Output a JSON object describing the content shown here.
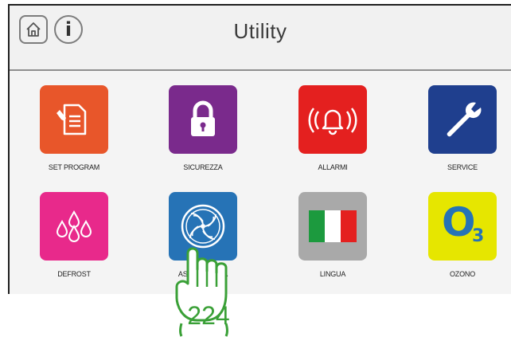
{
  "header": {
    "title": "Utility",
    "home_icon": "home-icon",
    "info_icon": "info-icon",
    "info_glyph": "i"
  },
  "tiles": [
    {
      "label": "SET PROGRAM",
      "icon": "document-edit-icon",
      "color": "#e8562a"
    },
    {
      "label": "SICUREZZA",
      "icon": "padlock-icon",
      "color": "#7a2a8c"
    },
    {
      "label": "ALLARMI",
      "icon": "alarm-bell-icon",
      "color": "#e4201f"
    },
    {
      "label": "SERVICE",
      "icon": "wrench-icon",
      "color": "#1f3f8e"
    },
    {
      "label": "DEFROST",
      "icon": "water-drops-icon",
      "color": "#e8298b"
    },
    {
      "label": "ASCIUGATURA",
      "icon": "fan-icon",
      "color": "#2673b6"
    },
    {
      "label": "LINGUA",
      "icon": "italian-flag-icon",
      "color": "#a9a9a9"
    },
    {
      "label": "OZONO",
      "icon": "ozone-o3-icon",
      "color": "#e6e600",
      "glyph_main": "O",
      "glyph_sub": "3"
    }
  ],
  "overlay": {
    "icon": "tap-hand-icon",
    "step_number": "224",
    "color": "#3aa037"
  }
}
